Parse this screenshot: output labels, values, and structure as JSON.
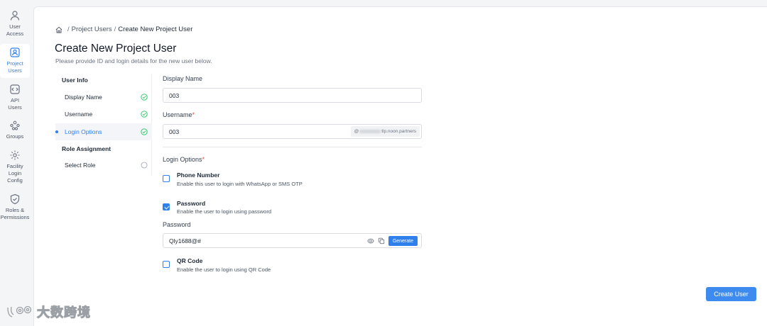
{
  "sidebar": {
    "items": [
      {
        "icon": "user-icon",
        "label": "User\nAccess",
        "active": false
      },
      {
        "icon": "project-users-icon",
        "label": "Project\nUsers",
        "active": true
      },
      {
        "icon": "api-icon",
        "label": "API\nUsers",
        "active": false
      },
      {
        "icon": "groups-icon",
        "label": "Groups",
        "active": false
      },
      {
        "icon": "facility-config-icon",
        "label": "Facility\nLogin\nConfig",
        "active": false
      },
      {
        "icon": "shield-icon",
        "label": "Roles &\nPermissions",
        "active": false
      }
    ]
  },
  "breadcrumb": {
    "items": [
      "Project Users",
      "Create New Project User"
    ],
    "separator": "/"
  },
  "page": {
    "title": "Create New Project User",
    "subtitle": "Please provide ID and login details for the new user below."
  },
  "stepper": {
    "sections": [
      {
        "title": "User Info",
        "steps": [
          {
            "label": "Display Name",
            "status": "complete"
          },
          {
            "label": "Username",
            "status": "complete"
          },
          {
            "label": "Login Options",
            "status": "current"
          }
        ]
      },
      {
        "title": "Role Assignment",
        "steps": [
          {
            "label": "Select Role",
            "status": "pending"
          }
        ]
      }
    ]
  },
  "form": {
    "display_name": {
      "label": "Display Name",
      "value": "003"
    },
    "username": {
      "label": "Username",
      "required_mark": "*",
      "value": "003",
      "suffix_start": "@",
      "suffix_end": "tlp.noon.partners"
    },
    "login_options": {
      "label": "Login Options",
      "required_mark": "*",
      "phone": {
        "title": "Phone Number",
        "desc": "Enable this user to login with WhatsApp or SMS OTP",
        "checked": false
      },
      "password": {
        "title": "Password",
        "desc": "Enable the user to login using password",
        "checked": true
      },
      "qr": {
        "title": "QR Code",
        "desc": "Enable the user to login using QR Code",
        "checked": false
      }
    },
    "password_field": {
      "label": "Password",
      "value": "Qly1688@#",
      "generate_label": "Generate"
    }
  },
  "actions": {
    "create_label": "Create User"
  },
  "watermark": {
    "text": "大数跨境"
  },
  "colors": {
    "accent": "#2f80ed",
    "success": "#22c55e",
    "required": "#e5484d"
  }
}
